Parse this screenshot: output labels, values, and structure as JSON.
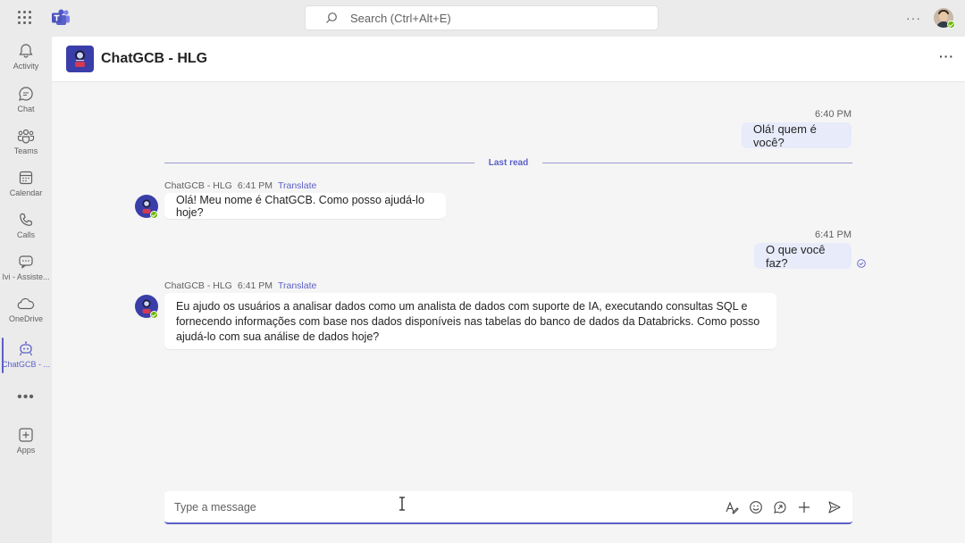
{
  "search": {
    "placeholder": "Search (Ctrl+Alt+E)"
  },
  "topbar": {
    "more": "···"
  },
  "rail": {
    "items": [
      {
        "label": "Activity",
        "icon": "bell-icon"
      },
      {
        "label": "Chat",
        "icon": "chat-icon"
      },
      {
        "label": "Teams",
        "icon": "teams-icon"
      },
      {
        "label": "Calendar",
        "icon": "calendar-icon"
      },
      {
        "label": "Calls",
        "icon": "phone-icon"
      },
      {
        "label": "Ivi - Assiste...",
        "icon": "assistant-icon"
      },
      {
        "label": "OneDrive",
        "icon": "cloud-icon"
      },
      {
        "label": "ChatGCB - ...",
        "icon": "bot-icon",
        "active": true
      },
      {
        "label": "Apps",
        "icon": "add-app-icon"
      }
    ],
    "more": "•••"
  },
  "header": {
    "title": "ChatGCB - HLG",
    "more": "···"
  },
  "messages": [
    {
      "from": "me",
      "time": "6:40 PM",
      "text": "Olá! quem é você?"
    },
    {
      "from": "bot",
      "sender": "ChatGCB - HLG",
      "time": "6:41 PM",
      "translate": "Translate",
      "text": "Olá! Meu nome é ChatGCB. Como posso ajudá-lo hoje?"
    },
    {
      "from": "me",
      "time": "6:41 PM",
      "text": "O que você faz?"
    },
    {
      "from": "bot",
      "sender": "ChatGCB - HLG",
      "time": "6:41 PM",
      "translate": "Translate",
      "text": "Eu ajudo os usuários a analisar dados como um analista de dados com suporte de IA, executando consultas SQL e fornecendo informações com base nos dados disponíveis nas tabelas do banco de dados da Databricks. Como posso ajudá-lo com sua análise de dados hoje?"
    }
  ],
  "divider": {
    "label": "Last read"
  },
  "composer": {
    "placeholder": "Type a message"
  },
  "colors": {
    "accent": "#5b5fc7",
    "bot_brand": "#3a3ea8",
    "my_bubble": "#e8ebfa",
    "presence": "#6bb700"
  }
}
